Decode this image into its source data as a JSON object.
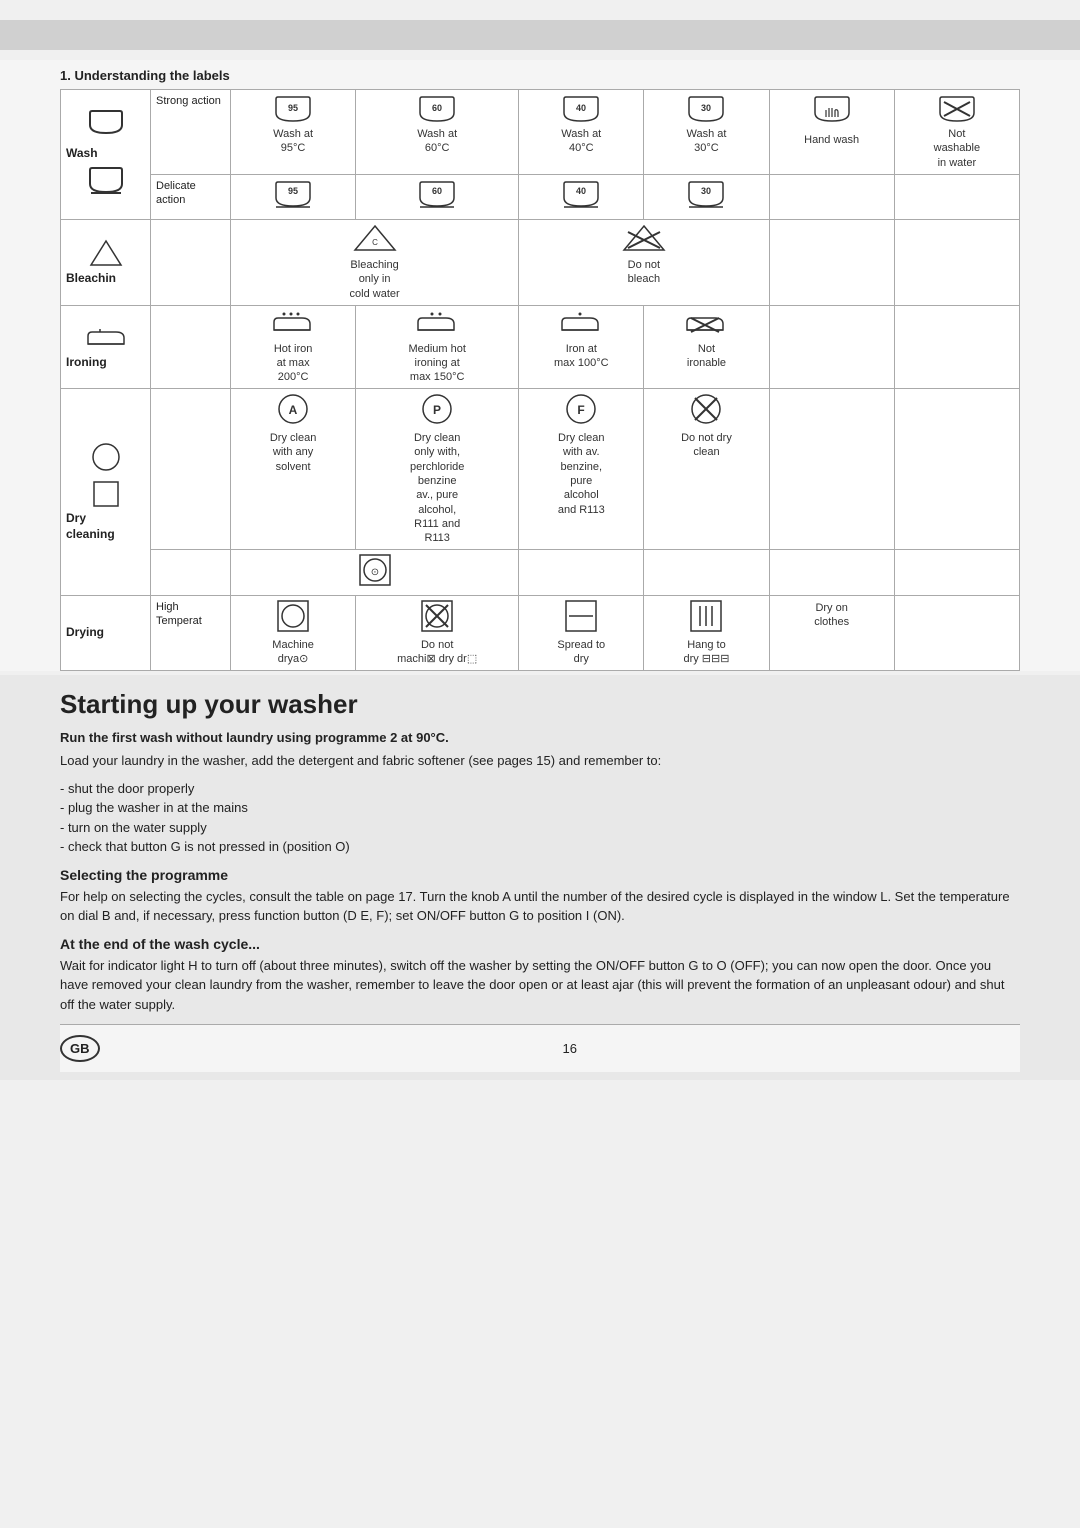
{
  "page": {
    "top_bar_color": "#c8c8c8",
    "bg_color": "#f0f0f0"
  },
  "labels_section": {
    "title": "1. Understanding the labels",
    "rows": {
      "wash": {
        "category": "Wash",
        "sub1": "Strong action",
        "sub2": "Delicate action",
        "col1_temp": "95°C",
        "col1_label": "Wash at 95°C",
        "col2_temp": "60°C",
        "col2_label": "Wash at 60°C",
        "col3_temp": "40°C",
        "col3_label": "Wash at 40°C",
        "col4_temp": "30°C",
        "col4_label": "Wash at 30°C",
        "col5_label": "Hand wash",
        "col6_label": "Not washable in water"
      },
      "bleach": {
        "category": "Bleachin",
        "col1_label": "Bleaching only in cold water",
        "col2_label": "Do not bleach"
      },
      "iron": {
        "category": "Ironing",
        "col1_label": "Hot iron at max 200°C",
        "col2_label": "Medium hot ironing at max 150°C",
        "col3_label": "Iron at max 100°C",
        "col4_label": "Not ironable"
      },
      "dry_cleaning": {
        "category": "Dry cleaning",
        "col1_letter": "A",
        "col1_label": "Dry clean with any solvent",
        "col2_letter": "P",
        "col2_label": "Dry clean only with, perchloride benzine av., pure alcohol, R111 and R113",
        "col3_letter": "F",
        "col3_label": "Dry clean with av. benzine, pure alcohol and R113",
        "col4_label": "Do not dry clean"
      },
      "drying": {
        "category": "Drying",
        "sub1": "High Temperat",
        "col1_label": "Machine drya",
        "col2_label": "Do not machine dry",
        "col3_label": "Spread to dry",
        "col4_label": "Hang to dry",
        "col5_label": "Dry on clothes"
      }
    }
  },
  "starting_section": {
    "title": "Starting up your washer",
    "bold_para": "Run the first wash without laundry using programme 2 at 90°C.",
    "para1": "Load your laundry in the washer, add the detergent and fabric softener (see pages 15) and remember to:",
    "bullets": [
      "- shut the door properly",
      "- plug the washer in at the mains",
      "- turn on the water supply",
      "- check that button G is not pressed in (position O)"
    ],
    "selecting_title": "Selecting the programme",
    "selecting_text": "For help on selecting the cycles, consult the table on page 17. Turn the knob A until the number of the desired cycle is displayed in the window L. Set the temperature on dial B and, if necessary, press function button (D E, F); set ON/OFF button G  to position I (ON).",
    "wash_end_title": "At the end of the wash cycle...",
    "wash_end_text": "Wait for indicator light H to turn off (about three minutes), switch off the washer by setting the ON/OFF button G to O (OFF); you can now open the door. Once you have removed your clean laundry from the washer, remember to leave the door open or at least ajar (this will prevent the formation of an unpleasant odour) and shut off the water supply.",
    "page_number": "16",
    "gb_badge": "GB"
  }
}
